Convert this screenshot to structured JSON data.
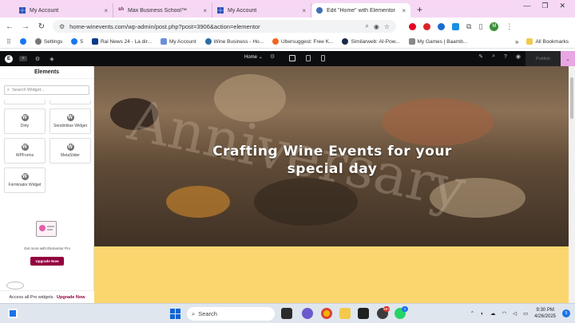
{
  "browser": {
    "tabs": [
      {
        "title": "My Account",
        "icon": "grid-icon"
      },
      {
        "title": "Max Business School™",
        "icon": "sh-icon"
      },
      {
        "title": "My Account",
        "icon": "grid-icon"
      },
      {
        "title": "Edit \"Home\" with Elementor",
        "icon": "wordpress-icon",
        "active": true
      }
    ],
    "url": "home-winevents.com/wp-admin/post.php?post=3906&action=elementor",
    "profile_initial": "M"
  },
  "bookmarks": {
    "items": [
      {
        "label": "Settings",
        "color": "#777777"
      },
      {
        "label": "5",
        "color": "#1877f2"
      },
      {
        "label": "Rai News 24 - La dir...",
        "color": "#0b3a8a"
      },
      {
        "label": "My Account",
        "color": "#6b8fd9"
      },
      {
        "label": "Wine Business - Ho...",
        "color": "#2e6da4"
      },
      {
        "label": "Ubersuggest: Free K...",
        "color": "#f26522"
      },
      {
        "label": "Similarweb: AI-Pow...",
        "color": "#1b2a4a"
      },
      {
        "label": "My Games | Baamb...",
        "color": "#888888"
      }
    ],
    "more": "»",
    "all_bookmarks": "All Bookmarks"
  },
  "elementor": {
    "page_selector": "Home",
    "publish_label": "Publish"
  },
  "panel": {
    "title": "Elements",
    "search_placeholder": "Search Widget...",
    "widgets": [
      "Dirty",
      "Sendinblue Widget",
      "WPForms",
      "MetaSlider",
      "Forminator Widget"
    ],
    "promo_text": "Get more with Elementor Pro",
    "upgrade_label": "Upgrade Now",
    "access_text": "Access all Pro widgets.",
    "access_link": "Upgrade Now"
  },
  "canvas": {
    "hero_title_line1": "Crafting Wine Events for your",
    "hero_title_line2": "special day",
    "watermark": "Anniversary"
  },
  "taskbar": {
    "search_label": "Search",
    "time": "9:30 PM",
    "date": "4/26/2025",
    "notification_count": "5",
    "badge_99": "99+",
    "badge_1": "1"
  }
}
